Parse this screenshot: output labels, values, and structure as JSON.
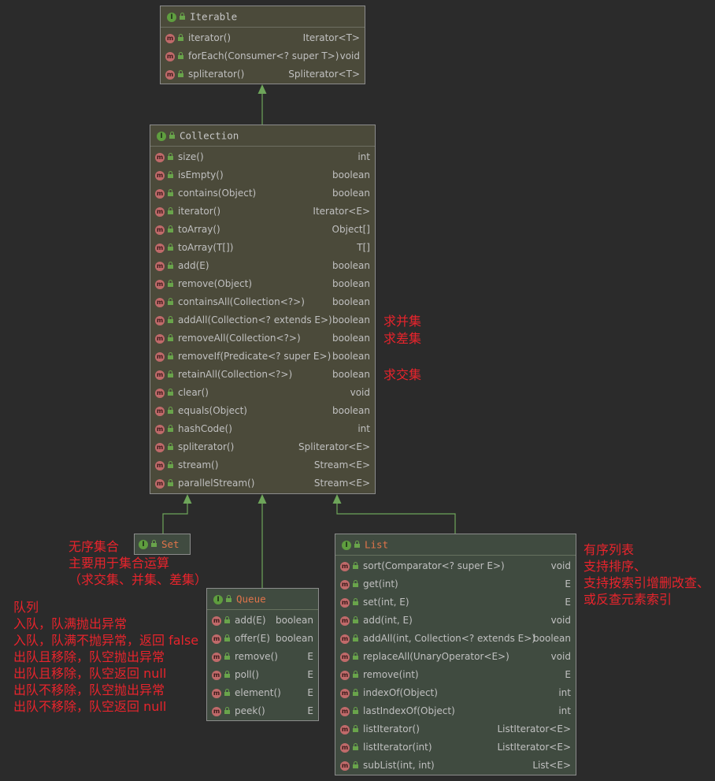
{
  "classes": {
    "iterable": {
      "name": "Iterable",
      "methods": [
        {
          "name": "iterator()",
          "ret": "Iterator<T>"
        },
        {
          "name": "forEach(Consumer<? super T>)",
          "ret": "void"
        },
        {
          "name": "spliterator()",
          "ret": "Spliterator<T>"
        }
      ]
    },
    "collection": {
      "name": "Collection",
      "methods": [
        {
          "name": "size()",
          "ret": "int"
        },
        {
          "name": "isEmpty()",
          "ret": "boolean"
        },
        {
          "name": "contains(Object)",
          "ret": "boolean"
        },
        {
          "name": "iterator()",
          "ret": "Iterator<E>"
        },
        {
          "name": "toArray()",
          "ret": "Object[]"
        },
        {
          "name": "toArray(T[])",
          "ret": "T[]"
        },
        {
          "name": "add(E)",
          "ret": "boolean"
        },
        {
          "name": "remove(Object)",
          "ret": "boolean"
        },
        {
          "name": "containsAll(Collection<?>)",
          "ret": "boolean"
        },
        {
          "name": "addAll(Collection<? extends E>)",
          "ret": "boolean"
        },
        {
          "name": "removeAll(Collection<?>)",
          "ret": "boolean"
        },
        {
          "name": "removeIf(Predicate<? super E>)",
          "ret": "boolean"
        },
        {
          "name": "retainAll(Collection<?>)",
          "ret": "boolean"
        },
        {
          "name": "clear()",
          "ret": "void"
        },
        {
          "name": "equals(Object)",
          "ret": "boolean"
        },
        {
          "name": "hashCode()",
          "ret": "int"
        },
        {
          "name": "spliterator()",
          "ret": "Spliterator<E>"
        },
        {
          "name": "stream()",
          "ret": "Stream<E>"
        },
        {
          "name": "parallelStream()",
          "ret": "Stream<E>"
        }
      ]
    },
    "set": {
      "name": "Set",
      "methods": []
    },
    "queue": {
      "name": "Queue",
      "methods": [
        {
          "name": "add(E)",
          "ret": "boolean"
        },
        {
          "name": "offer(E)",
          "ret": "boolean"
        },
        {
          "name": "remove()",
          "ret": "E"
        },
        {
          "name": "poll()",
          "ret": "E"
        },
        {
          "name": "element()",
          "ret": "E"
        },
        {
          "name": "peek()",
          "ret": "E"
        }
      ]
    },
    "list": {
      "name": "List",
      "methods": [
        {
          "name": "sort(Comparator<? super E>)",
          "ret": "void"
        },
        {
          "name": "get(int)",
          "ret": "E"
        },
        {
          "name": "set(int, E)",
          "ret": "E"
        },
        {
          "name": "add(int, E)",
          "ret": "void"
        },
        {
          "name": "addAll(int, Collection<? extends E>)",
          "ret": "boolean"
        },
        {
          "name": "replaceAll(UnaryOperator<E>)",
          "ret": "void"
        },
        {
          "name": "remove(int)",
          "ret": "E"
        },
        {
          "name": "indexOf(Object)",
          "ret": "int"
        },
        {
          "name": "lastIndexOf(Object)",
          "ret": "int"
        },
        {
          "name": "listIterator()",
          "ret": "ListIterator<E>"
        },
        {
          "name": "listIterator(int)",
          "ret": "ListIterator<E>"
        },
        {
          "name": "subList(int, int)",
          "ret": "List<E>"
        }
      ]
    }
  },
  "notes": {
    "union": "求并集",
    "difference": "求差集",
    "intersection": "求交集",
    "set_note": "无序集合\n主要用于集合运算\n（求交集、并集、差集）",
    "queue_note": "队列\n入队，队满抛出异常\n入队，队满不抛异常，返回 false\n出队且移除，队空抛出异常\n出队且移除，队空返回 null\n出队不移除，队空抛出异常\n出队不移除，队空返回 null",
    "list_note": "有序列表\n支持排序、\n支持按索引增删改查、\n或反查元素索引"
  },
  "colors": {
    "background": "#2b2b2b",
    "interface_box": "#4b4a3a",
    "interface_box_alt": "#404b40",
    "interface_badge": "#5f9e3f",
    "method_badge": "#c06a6a",
    "edge": "#6ea55a",
    "annotation": "#e8242c"
  }
}
